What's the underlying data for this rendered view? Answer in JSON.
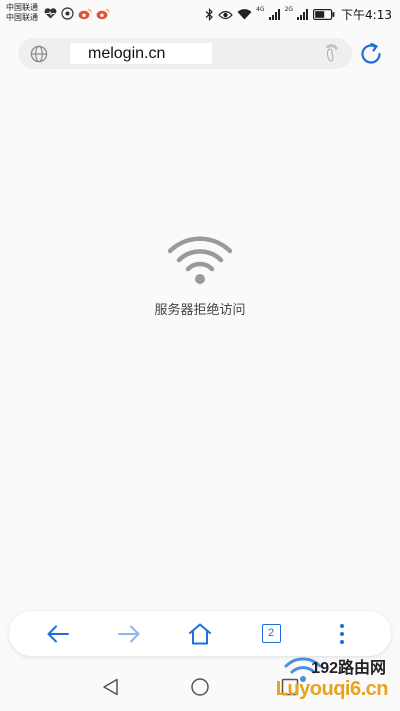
{
  "status_bar": {
    "carrier_1": "中国联通",
    "carrier_2": "中国联通",
    "network_1": "4G",
    "network_2": "2G",
    "time": "下午4:13",
    "battery_level": 0.6
  },
  "address_bar": {
    "url": "melogin.cn"
  },
  "error": {
    "message": "服务器拒绝访问"
  },
  "toolbar": {
    "tab_count": "2"
  },
  "watermark": {
    "brand": "192路由网",
    "site": "Luyouqi6.cn"
  },
  "colors": {
    "accent": "#1e6fd9",
    "error_icon": "#9a9a9a",
    "watermark_gold": "#e8a31a"
  }
}
